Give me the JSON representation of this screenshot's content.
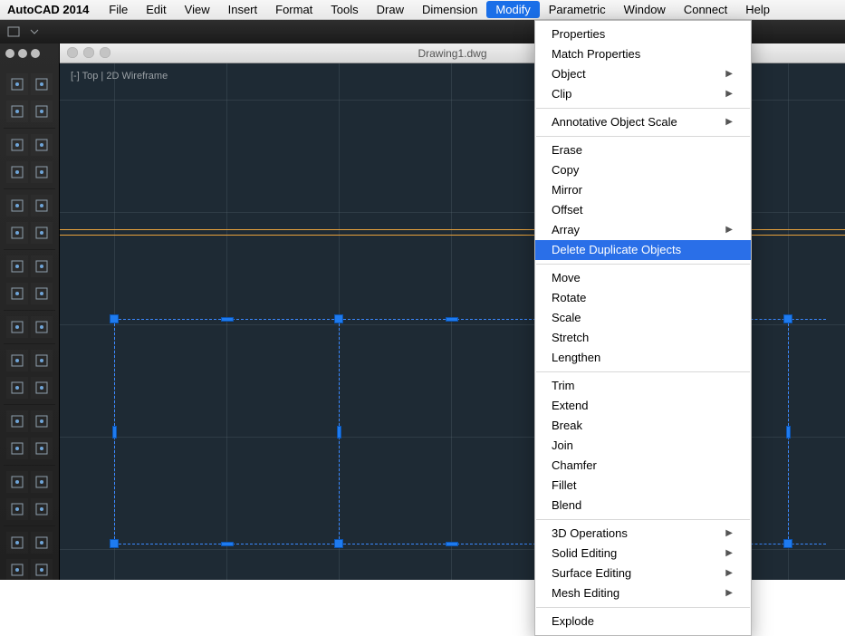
{
  "app_name": "AutoCAD 2014",
  "menubar": [
    "File",
    "Edit",
    "View",
    "Insert",
    "Format",
    "Tools",
    "Draw",
    "Dimension",
    "Modify",
    "Parametric",
    "Window",
    "Connect",
    "Help"
  ],
  "active_menu": "Modify",
  "document_title": "Drawing1.dwg",
  "viewport_label": "[-] Top | 2D Wireframe",
  "dropdown": {
    "groups": [
      [
        {
          "label": "Properties",
          "submenu": false
        },
        {
          "label": "Match Properties",
          "submenu": false
        },
        {
          "label": "Object",
          "submenu": true
        },
        {
          "label": "Clip",
          "submenu": true
        }
      ],
      [
        {
          "label": "Annotative Object Scale",
          "submenu": true
        }
      ],
      [
        {
          "label": "Erase",
          "submenu": false
        },
        {
          "label": "Copy",
          "submenu": false
        },
        {
          "label": "Mirror",
          "submenu": false
        },
        {
          "label": "Offset",
          "submenu": false
        },
        {
          "label": "Array",
          "submenu": true
        },
        {
          "label": "Delete Duplicate Objects",
          "submenu": false,
          "highlight": true
        }
      ],
      [
        {
          "label": "Move",
          "submenu": false
        },
        {
          "label": "Rotate",
          "submenu": false
        },
        {
          "label": "Scale",
          "submenu": false
        },
        {
          "label": "Stretch",
          "submenu": false
        },
        {
          "label": "Lengthen",
          "submenu": false
        }
      ],
      [
        {
          "label": "Trim",
          "submenu": false
        },
        {
          "label": "Extend",
          "submenu": false
        },
        {
          "label": "Break",
          "submenu": false
        },
        {
          "label": "Join",
          "submenu": false
        },
        {
          "label": "Chamfer",
          "submenu": false
        },
        {
          "label": "Fillet",
          "submenu": false
        },
        {
          "label": "Blend",
          "submenu": false
        }
      ],
      [
        {
          "label": "3D Operations",
          "submenu": true
        },
        {
          "label": "Solid Editing",
          "submenu": true
        },
        {
          "label": "Surface Editing",
          "submenu": true
        },
        {
          "label": "Mesh Editing",
          "submenu": true
        }
      ],
      [
        {
          "label": "Explode",
          "submenu": false
        }
      ]
    ]
  },
  "tool_groups": [
    [
      "line-tool",
      "rectangle-tool"
    ],
    [
      "arrow-left-tool",
      "arrow-right-tool"
    ],
    [
      "polyline-tool",
      "arc-tool"
    ],
    [
      "spline-tool",
      "revision-tool"
    ],
    [
      "sphere-tool",
      "hatch-tool"
    ],
    [
      "region-tool",
      "crop-tool"
    ],
    [
      "layer-tool",
      "match-tool"
    ],
    [
      "tag-tool",
      "dimension-tool"
    ],
    [
      "box-tool",
      "erase-tool"
    ],
    [
      "move-tool",
      "rotate-tool"
    ],
    [
      "scale-tool",
      "stretch-tool"
    ],
    [
      "array-tool",
      "align-tool"
    ],
    [
      "mirror-tool",
      "offset-tool"
    ],
    [
      "break-tool",
      "extend-tool"
    ],
    [
      "trim-tool",
      "fillet-tool"
    ],
    [
      "measure-tool",
      "inspect-tool"
    ],
    [
      "camera-tool",
      "option-tool"
    ]
  ],
  "colors": {
    "canvas": "#1e2a34",
    "select": "#1e7bf0",
    "orange": "#e8a23c",
    "menu_highlight": "#2a6fe8"
  }
}
